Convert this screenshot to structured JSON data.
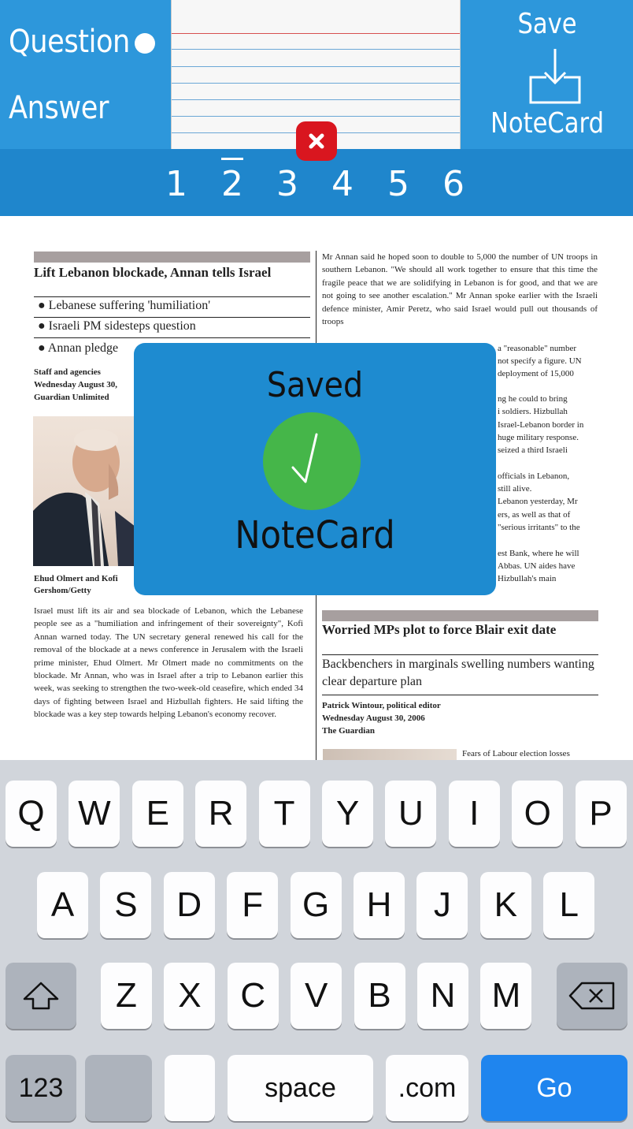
{
  "header": {
    "question_label": "Question",
    "answer_label": "Answer",
    "save_top_label": "Save",
    "save_bottom_label": "NoteCard",
    "save_icon": "download-tray-icon",
    "delete_icon": "close-icon"
  },
  "pages": {
    "numbers": [
      "1",
      "2",
      "3",
      "4",
      "5",
      "6"
    ],
    "current": "2"
  },
  "document": {
    "headline": "Lift Lebanon blockade, Annan tells Israel",
    "bullets": [
      "Lebanese suffering 'humiliation'",
      "Israeli PM sidesteps question",
      "Annan pledge"
    ],
    "byline": "Staff and agencies\nWednesday August 30,\nGuardian Unlimited",
    "photo_caption": "Ehud Olmert and Kofi\nGershom/Getty",
    "left_body": "Israel must lift its air and sea blockade of Lebanon, which the Lebanese people see as a \"humiliation and infringement of their sovereignty\", Kofi Annan warned today. The UN secretary general renewed his call for the removal of the blockade at a news conference in Jerusalem with the Israeli prime minister, Ehud Olmert. Mr Olmert made no commitments on the blockade. Mr Annan, who was in Israel after a trip to Lebanon earlier this week, was seeking to strengthen the two-week-old ceasefire, which ended 34 days of fighting between Israel and Hizbullah fighters. He said lifting the blockade was a key step towards helping Lebanon's economy recover.",
    "right_body": "Mr Annan said he hoped soon to double to 5,000 the number of UN troops in southern Lebanon. \"We should all work together to ensure that this time the fragile peace that we are solidifying in Lebanon is for good, and that we are not going to see another escalation.\" Mr Annan spoke earlier with the Israeli defence minister, Amir Peretz, who said Israel would pull out thousands of troops",
    "right_body_2": "ng he could to bring\ni soldiers. Hizbullah\nIsrael-Lebanon border in\nhuge military response.\nseized a third Israeli\n\nofficials in Lebanon,\nstill alive.\nLebanon yesterday, Mr\ners, as well as that of\n\"serious irritants\" to the\n\nest Bank, where he will\nAbbas. UN aides have\nHizbullah's main",
    "right_body_2_extra": "a \"reasonable\" number\nnot specify a figure. UN\ndeployment of 15,000",
    "second_headline": "Worried MPs plot to force Blair exit date",
    "second_subhead": "Backbenchers in marginals swelling numbers wanting clear departure plan",
    "second_byline": "Patrick Wintour, political editor\nWednesday August 30, 2006\nThe Guardian",
    "second_teaser": "Fears of Labour election losses"
  },
  "toast": {
    "title": "Saved",
    "subtitle": "NoteCard",
    "icon": "checkmark-icon",
    "color": "#1e8bd0",
    "check_color": "#45b649"
  },
  "keyboard": {
    "row1": [
      "Q",
      "W",
      "E",
      "R",
      "T",
      "Y",
      "U",
      "I",
      "O",
      "P"
    ],
    "row2": [
      "A",
      "S",
      "D",
      "F",
      "G",
      "H",
      "J",
      "K",
      "L"
    ],
    "row3": [
      "Z",
      "X",
      "C",
      "V",
      "B",
      "N",
      "M"
    ],
    "shift_icon": "shift-icon",
    "backspace_icon": "backspace-icon",
    "numbers_label": "123",
    "space_label": "space",
    "dotcom_label": ".com",
    "go_label": "Go",
    "go_color": "#1f85ee"
  }
}
